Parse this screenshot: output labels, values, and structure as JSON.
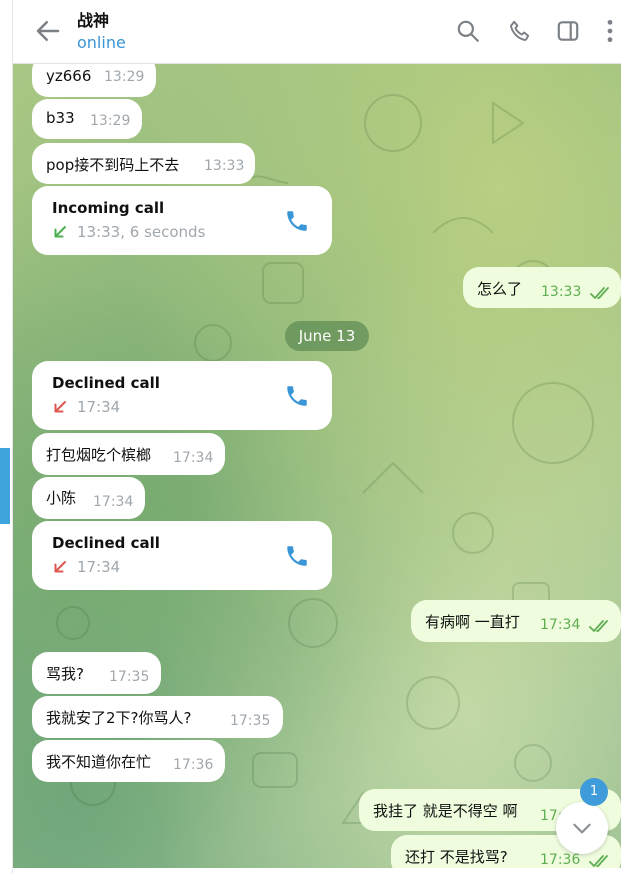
{
  "header": {
    "title": "战神",
    "status": "online",
    "icons": [
      "arrow-left-icon",
      "search-icon",
      "phone-icon",
      "sidebar-toggle-icon",
      "more-vertical-icon"
    ]
  },
  "date_separator": "June 13",
  "messages": [
    {
      "text": "yz666",
      "time": "13:29",
      "direction": "in"
    },
    {
      "text": "b33",
      "time": "13:29",
      "direction": "in"
    },
    {
      "text": "pop接不到码上不去",
      "time": "13:33",
      "direction": "in"
    },
    {
      "type": "call",
      "title": "Incoming call",
      "meta": "13:33, 6 seconds",
      "status": "incoming",
      "direction": "in"
    },
    {
      "text": "怎么了",
      "time": "13:33",
      "direction": "out"
    },
    {
      "type": "call",
      "title": "Declined call",
      "meta": "17:34",
      "status": "declined",
      "direction": "in"
    },
    {
      "text": "打包烟吃个槟榔",
      "time": "17:34",
      "direction": "in"
    },
    {
      "text": "小陈",
      "time": "17:34",
      "direction": "in"
    },
    {
      "type": "call",
      "title": "Declined call",
      "meta": "17:34",
      "status": "declined",
      "direction": "in"
    },
    {
      "text": "有病啊 一直打",
      "time": "17:34",
      "direction": "out"
    },
    {
      "text": "骂我?",
      "time": "17:35",
      "direction": "in"
    },
    {
      "text": "我就安了2下?你骂人?",
      "time": "17:35",
      "direction": "in"
    },
    {
      "text": "我不知道你在忙",
      "time": "17:36",
      "direction": "in"
    },
    {
      "text": "我挂了 就是不得空 啊",
      "time": "17:36",
      "direction": "out"
    },
    {
      "text": "还打 不是找骂?",
      "time": "17:36",
      "direction": "out"
    }
  ],
  "unread_count": "1",
  "colors": {
    "accent": "#3a96d6",
    "incoming_arrow": "#4caf50",
    "declined_arrow": "#e0564f",
    "outgoing_bubble": "#effdde",
    "read_ticks": "#5fae52"
  }
}
